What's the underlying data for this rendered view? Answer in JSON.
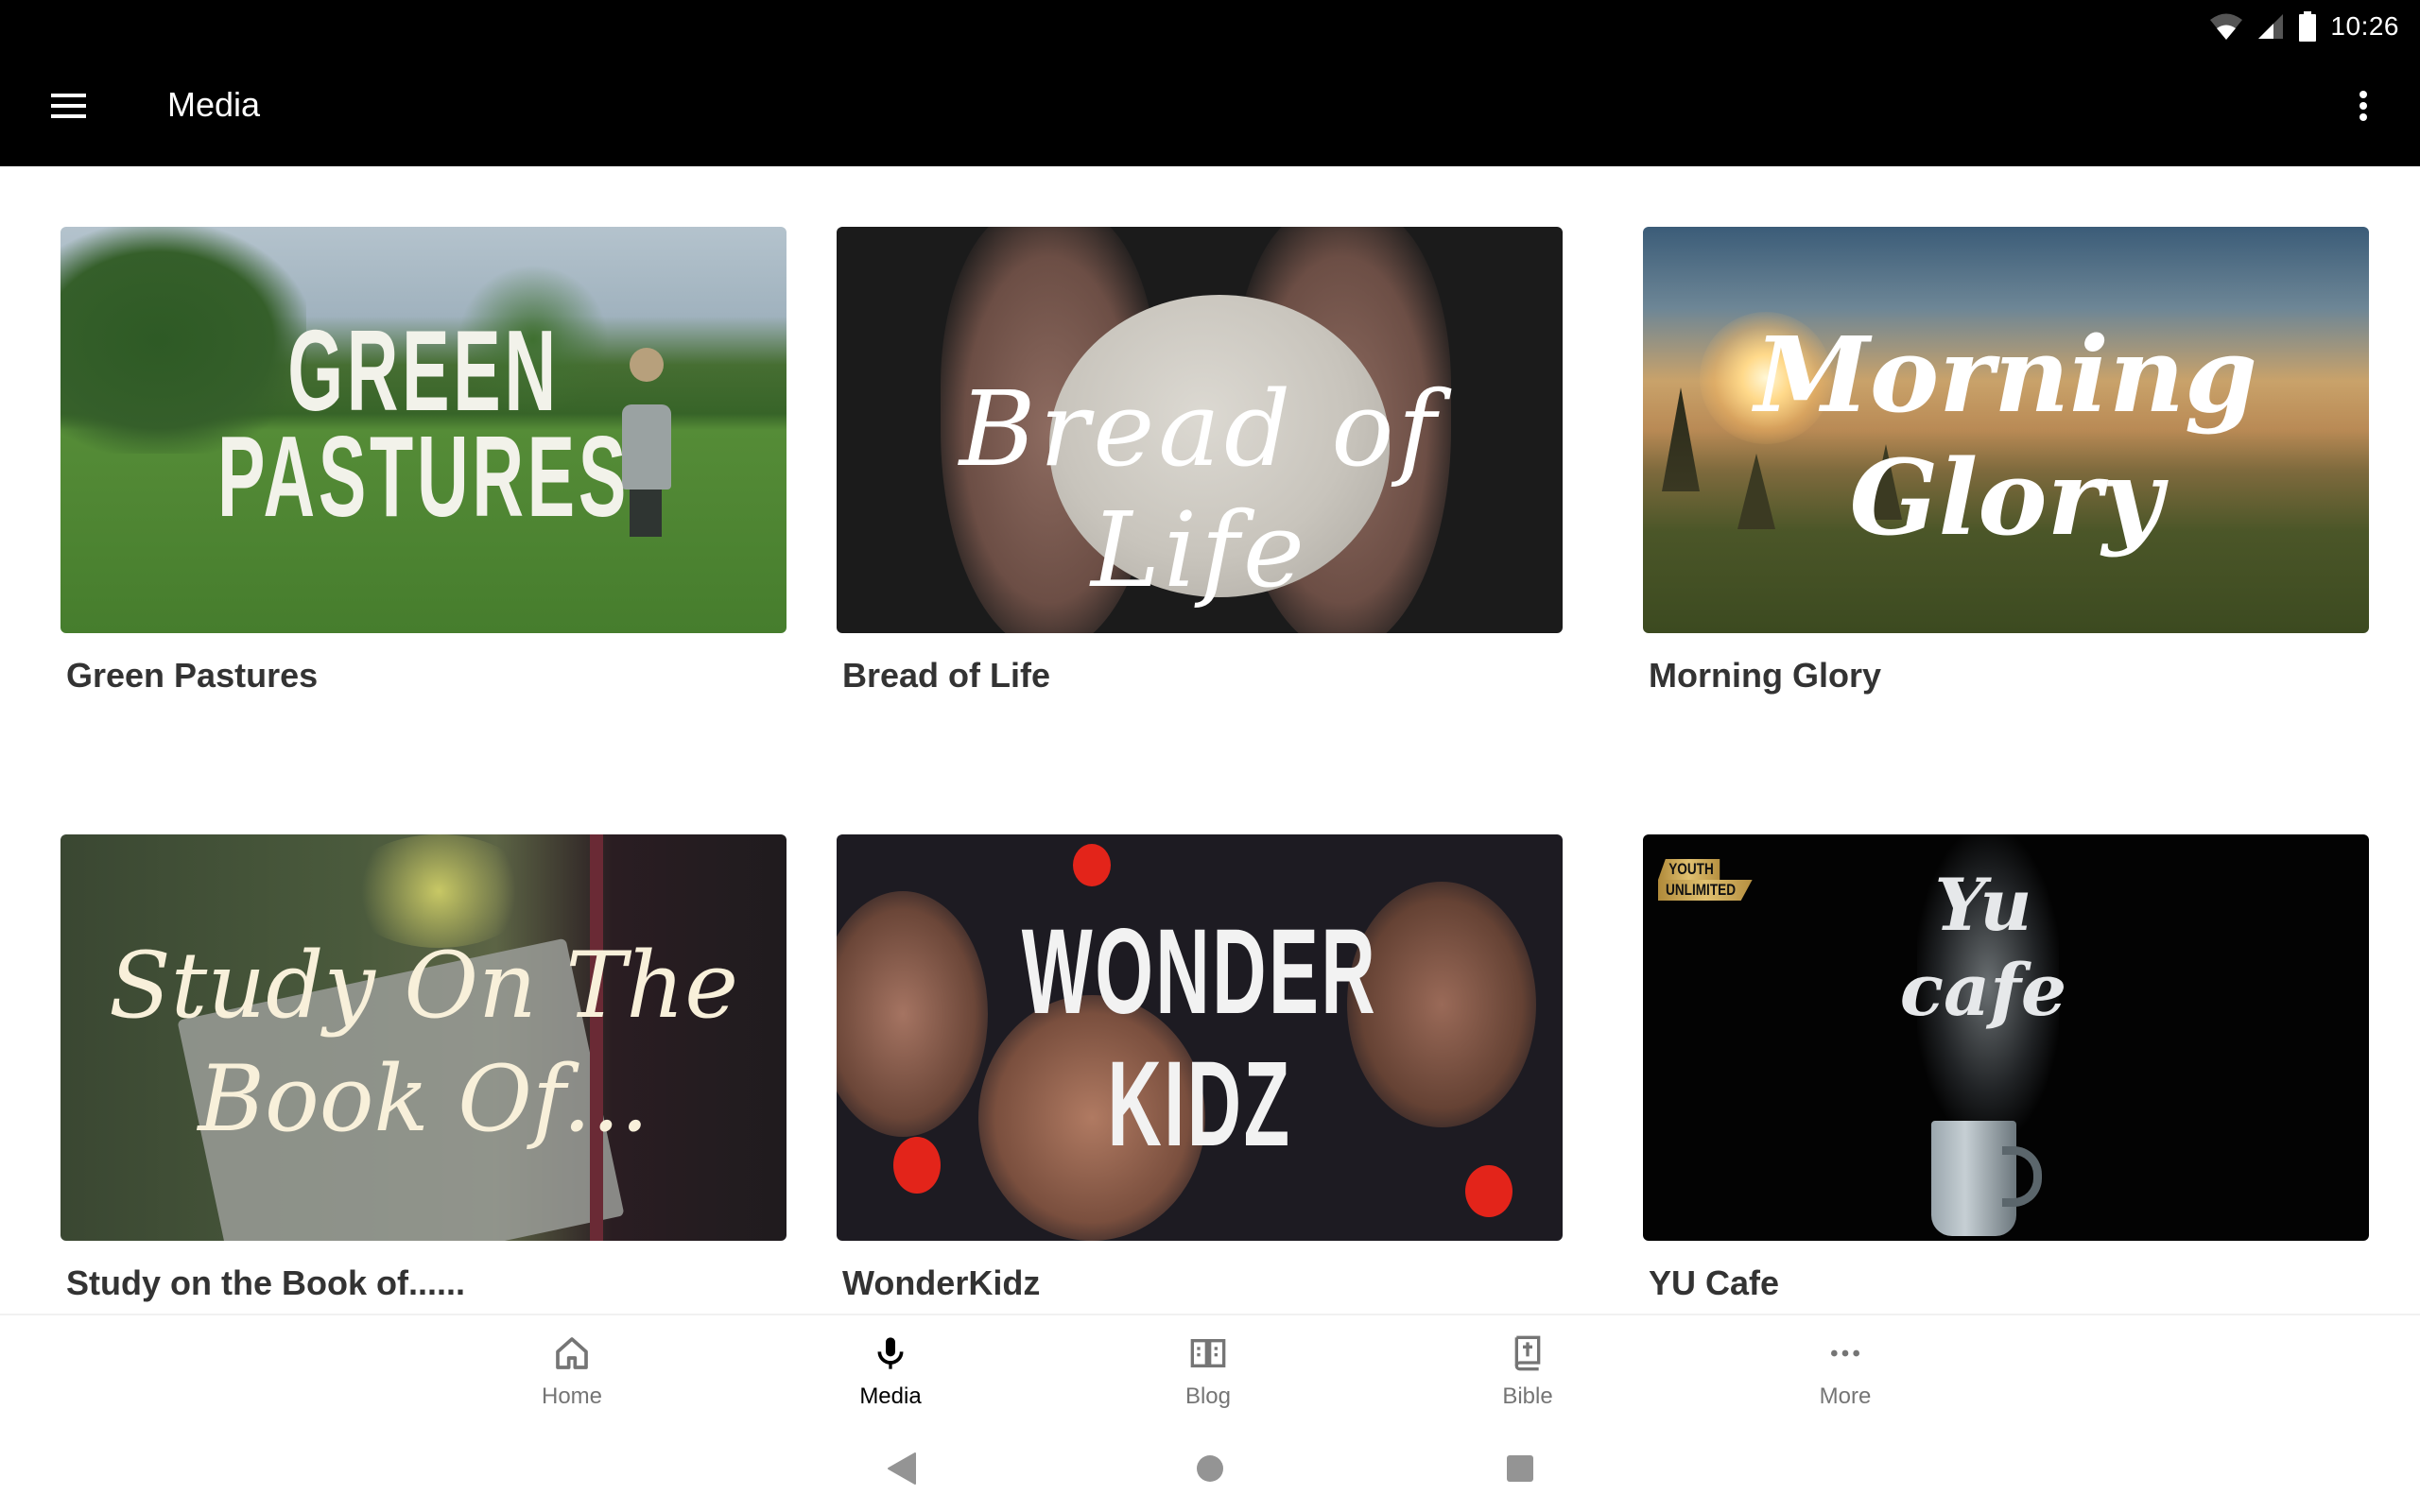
{
  "status_bar": {
    "time": "10:26",
    "icons": [
      "wifi-icon",
      "cell-signal-icon",
      "battery-icon"
    ]
  },
  "app_bar": {
    "title": "Media",
    "menu_icon": "hamburger-menu-icon",
    "overflow_icon": "more-vert-icon"
  },
  "media_items": [
    {
      "title": "Green Pastures",
      "thumb_text_lines": [
        "GREEN",
        "PASTURES"
      ]
    },
    {
      "title": "Bread of Life",
      "thumb_text_lines": [
        "Bread of Life"
      ]
    },
    {
      "title": "Morning Glory",
      "thumb_text_lines": [
        "Morning",
        "Glory"
      ]
    },
    {
      "title": "Study on the Book of......",
      "thumb_text_lines": [
        "Study On The",
        "Book Of..."
      ]
    },
    {
      "title": "WonderKidz",
      "thumb_text_lines": [
        "WONDER",
        "KIDZ"
      ]
    },
    {
      "title": "YU Cafe",
      "thumb_text_lines": [
        "Yu",
        "cafe"
      ],
      "badge_lines": [
        "YOUTH",
        "UNLIMITED"
      ]
    }
  ],
  "bottom_nav": {
    "active_index": 1,
    "items": [
      {
        "label": "Home",
        "icon": "home-icon"
      },
      {
        "label": "Media",
        "icon": "microphone-icon"
      },
      {
        "label": "Blog",
        "icon": "open-book-icon"
      },
      {
        "label": "Bible",
        "icon": "bible-icon"
      },
      {
        "label": "More",
        "icon": "more-horiz-icon"
      }
    ]
  },
  "system_nav": {
    "buttons": [
      "back",
      "home",
      "recents"
    ]
  },
  "colors": {
    "app_bar_bg": "#000000",
    "title_text": "#333333",
    "nav_inactive": "#757575",
    "nav_active": "#000000",
    "system_nav_icon": "#949494"
  }
}
